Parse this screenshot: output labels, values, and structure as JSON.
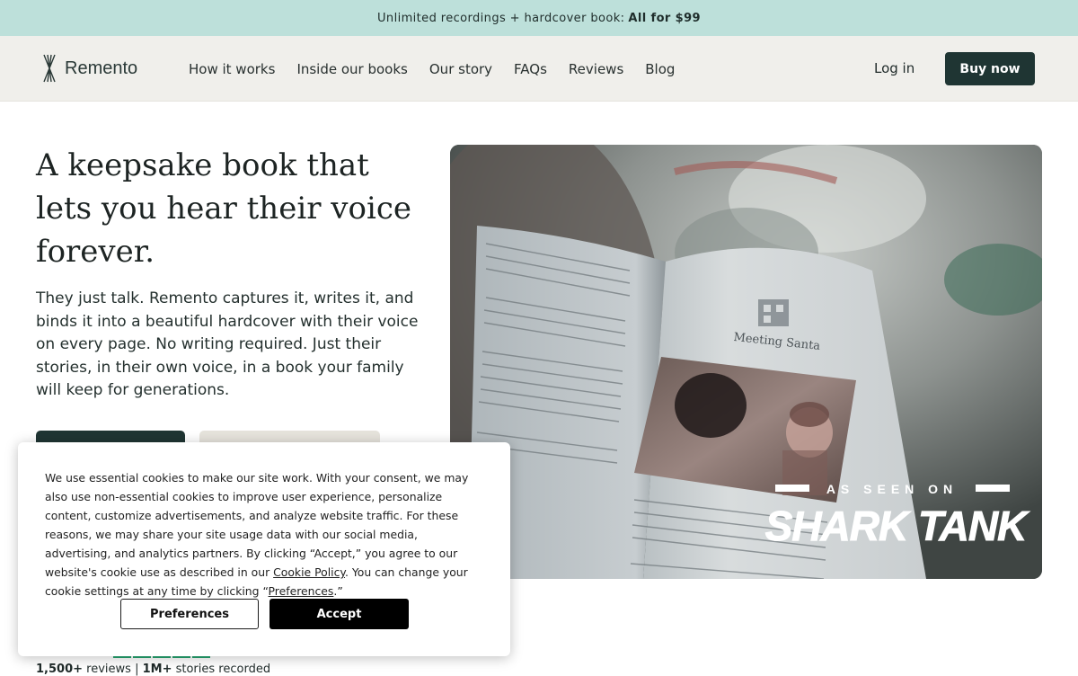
{
  "promo": {
    "text": "Unlimited recordings + hardcover book:",
    "bold": "All for $99"
  },
  "header": {
    "brand": "Remento",
    "logo_icon": "remento-logo-icon",
    "nav": [
      "How it works",
      "Inside our books",
      "Our story",
      "FAQs",
      "Reviews",
      "Blog"
    ],
    "login": "Log in",
    "buy": "Buy now"
  },
  "hero": {
    "title": "A keepsake book that lets you hear their voice forever.",
    "subtitle": "They just talk. Remento captures it, writes it, and binds it into a beautiful hardcover with their voice on every page. No writing required. Just their stories, in their own voice, in a book your family will keep for generations."
  },
  "image": {
    "book_chapter": "Meeting Santa",
    "badge_top": "AS SEEN ON",
    "badge_main": "SHARK TANK"
  },
  "social_proof": {
    "reviews_count": "1,500+",
    "reviews_label": "reviews",
    "divider": "|",
    "stories_count": "1M+",
    "stories_label": "stories recorded",
    "rating_stars": 5
  },
  "cookie": {
    "text_1": "We use essential cookies to make our site work. With your consent, we may also use non-essential cookies to improve user experience, personalize content, customize advertisements, and analyze website traffic. For these reasons, we may share your site usage data with our social media, advertising, and analytics partners. By clicking “Accept,” you agree to our website's cookie use as described in our ",
    "policy_link": "Cookie Policy",
    "text_2": ". You can change your cookie settings at any time by clicking “",
    "pref_link": "Preferences",
    "text_3": ".”",
    "preferences_button": "Preferences",
    "accept_button": "Accept"
  },
  "colors": {
    "promo_bg": "#bde0da",
    "nav_bg": "#f0efeb",
    "brand_dark": "#1f3533",
    "star_green": "#25a36f"
  }
}
